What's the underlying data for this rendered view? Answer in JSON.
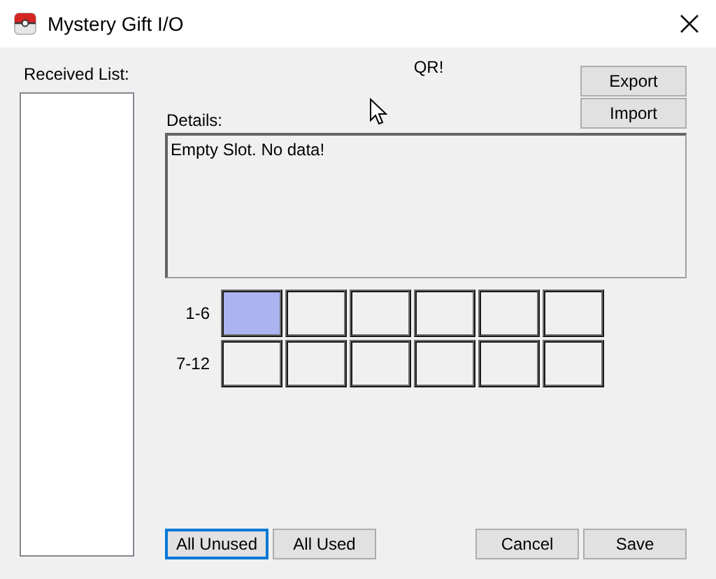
{
  "window": {
    "title": "Mystery Gift I/O"
  },
  "received_list": {
    "label": "Received List:"
  },
  "qr_label": "QR!",
  "side_buttons": [
    {
      "label": "Export"
    },
    {
      "label": "Import"
    }
  ],
  "details": {
    "label": "Details:",
    "value": "Empty Slot. No data!"
  },
  "slot_rows": [
    {
      "label": "1-6",
      "slots": [
        {
          "selected": true
        },
        {
          "selected": false
        },
        {
          "selected": false
        },
        {
          "selected": false
        },
        {
          "selected": false
        },
        {
          "selected": false
        }
      ]
    },
    {
      "label": "7-12",
      "slots": [
        {
          "selected": false
        },
        {
          "selected": false
        },
        {
          "selected": false
        },
        {
          "selected": false
        },
        {
          "selected": false
        },
        {
          "selected": false
        }
      ]
    }
  ],
  "bottom_left_buttons": [
    {
      "label": "All Unused",
      "focused": true
    },
    {
      "label": "All Used",
      "focused": false
    }
  ],
  "bottom_right_buttons": [
    {
      "label": "Cancel",
      "focused": false
    },
    {
      "label": "Save",
      "focused": false
    }
  ]
}
